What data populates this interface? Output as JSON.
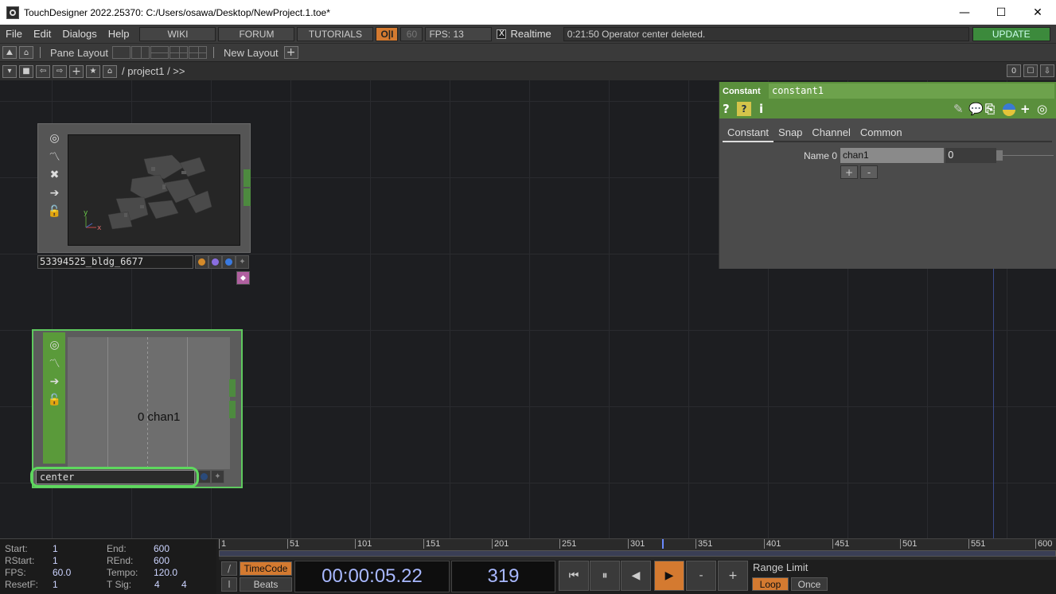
{
  "window": {
    "title": "TouchDesigner 2022.25370: C:/Users/osawa/Desktop/NewProject.1.toe*",
    "minimize": "—",
    "maximize": "☐",
    "close": "✕"
  },
  "menubar": {
    "items": [
      "File",
      "Edit",
      "Dialogs",
      "Help"
    ],
    "wiki": "WIKI",
    "forum": "FORUM",
    "tutorials": "TUTORIALS",
    "oi": "O|I",
    "fps_cap": "60",
    "fps_label": "FPS:  13",
    "realtime_label": "Realtime",
    "realtime_checked": "X",
    "status": "0:21:50 Operator center deleted.",
    "update": "UPDATE"
  },
  "panebar": {
    "pane_layout": "Pane Layout",
    "new_layout": "New Layout",
    "add": "+"
  },
  "pathbar": {
    "path": "/ project1 / >>",
    "counter": "0"
  },
  "nodes": {
    "geo": {
      "name": "53394525_bldg_6677",
      "axis_y": "y",
      "axis_x": "x",
      "flag_colors": [
        "#d48a2a",
        "#8a6ee0",
        "#3a7ae0"
      ]
    },
    "const": {
      "name": "center",
      "viewer_text": "0 chan1"
    }
  },
  "params": {
    "op_type": "Constant",
    "op_name": "constant1",
    "help_icon": "?",
    "info_icon": "i",
    "tabs": [
      "Constant",
      "Snap",
      "Channel",
      "Common"
    ],
    "row_label": "Name 0",
    "row_name": "chan1",
    "row_value": "0",
    "plus": "+",
    "minus": "-"
  },
  "timeline": {
    "start_label": "Start:",
    "start": "1",
    "end_label": "End:",
    "end": "600",
    "rstart_label": "RStart:",
    "rstart": "1",
    "rend_label": "REnd:",
    "rend": "600",
    "fps_label": "FPS:",
    "fps": "60.0",
    "tempo_label": "Tempo:",
    "tempo": "120.0",
    "resetf_label": "ResetF:",
    "resetf": "1",
    "tsig_label": "T Sig:",
    "tsig_a": "4",
    "tsig_b": "4",
    "ticks": [
      "1",
      "51",
      "101",
      "151",
      "201",
      "251",
      "301",
      "351",
      "401",
      "451",
      "501",
      "551",
      "600"
    ],
    "timecode_btn": "TimeCode",
    "beats_btn": "Beats",
    "slash_top": "/",
    "slash_bottom": "I",
    "timecode": "00:00:05.22",
    "frame": "319",
    "range_limit": "Range Limit",
    "loop": "Loop",
    "once": "Once"
  },
  "colors": {
    "accent_orange": "#d47a30",
    "param_header_green": "#5a8f3c",
    "selection_green": "#5ed85e",
    "update_green": "#3c8a3c"
  }
}
